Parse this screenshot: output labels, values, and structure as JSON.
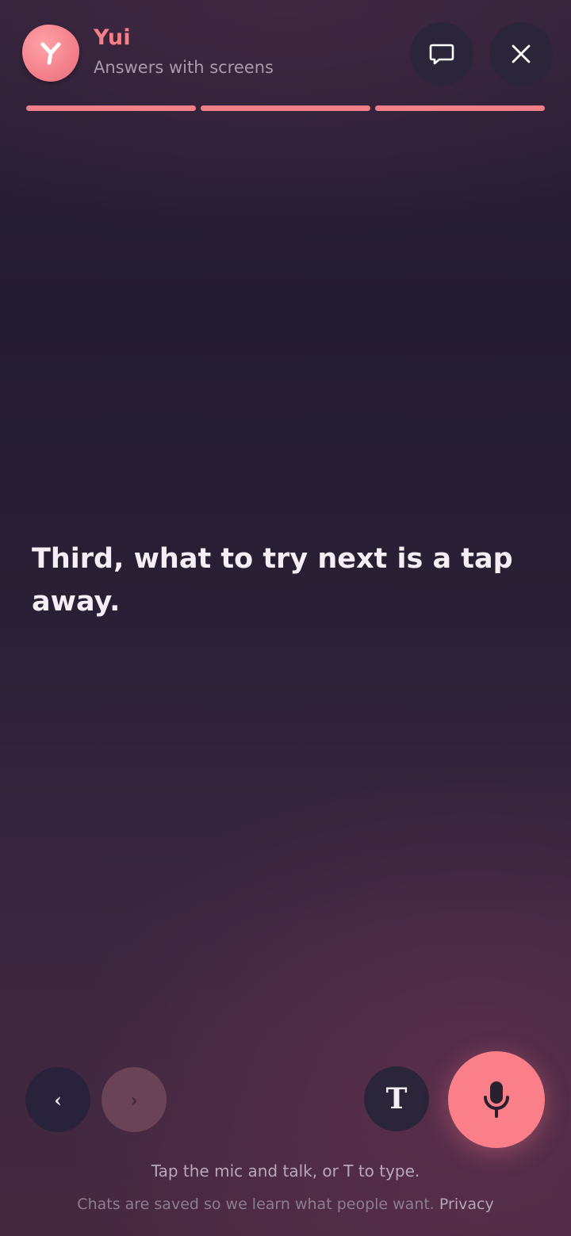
{
  "header": {
    "name": "Yui",
    "subtitle": "Answers with screens",
    "avatar_icon": "yui-logo-icon",
    "chat_icon": "chat-bubble-icon",
    "close_icon": "close-icon"
  },
  "progress": {
    "segments_total": 3,
    "segments_filled": 3,
    "color": "#f37f88"
  },
  "message": {
    "text": "Third, what to try next is a tap away."
  },
  "controls": {
    "prev_label": "‹",
    "next_label": "›",
    "type_label": "T",
    "mic_icon": "microphone-icon",
    "mic_color": "#fb7f89"
  },
  "hint": "Tap the mic and talk, or T to type.",
  "footer": {
    "text": "Chats are saved so we learn what people want.",
    "privacy_link": "Privacy"
  }
}
